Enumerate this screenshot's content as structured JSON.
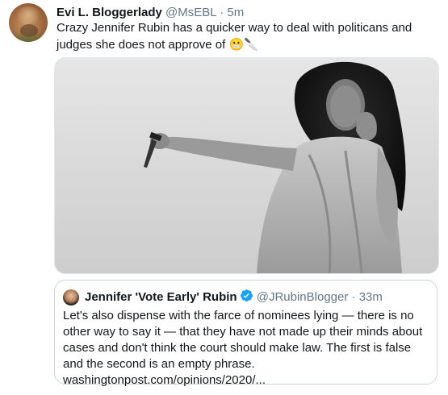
{
  "tweet": {
    "author_name": "Evi L. Bloggerlady",
    "author_handle": "@MsEBL",
    "separator": "·",
    "time": "5m",
    "text": "Crazy Jennifer Rubin has a quicker way to deal with politicans and judges she does not approve of",
    "emoji_1": "😬",
    "emoji_2": "🔪"
  },
  "quoted_tweet": {
    "author_name": "Jennifer 'Vote Early' Rubin",
    "author_handle": "@JRubinBlogger",
    "separator": "·",
    "time": "33m",
    "text": "Let's also dispense with the farce of nominees lying — there is no other way to say it — that they have not made up their minds about cases and don't think the court should make law. The first is false and the second is an empty phrase.",
    "link": "washingtonpost.com/opinions/2020/..."
  },
  "colors": {
    "text": "#14171a",
    "secondary": "#657786",
    "verified": "#1da1f2",
    "border": "#ccd6dd"
  }
}
